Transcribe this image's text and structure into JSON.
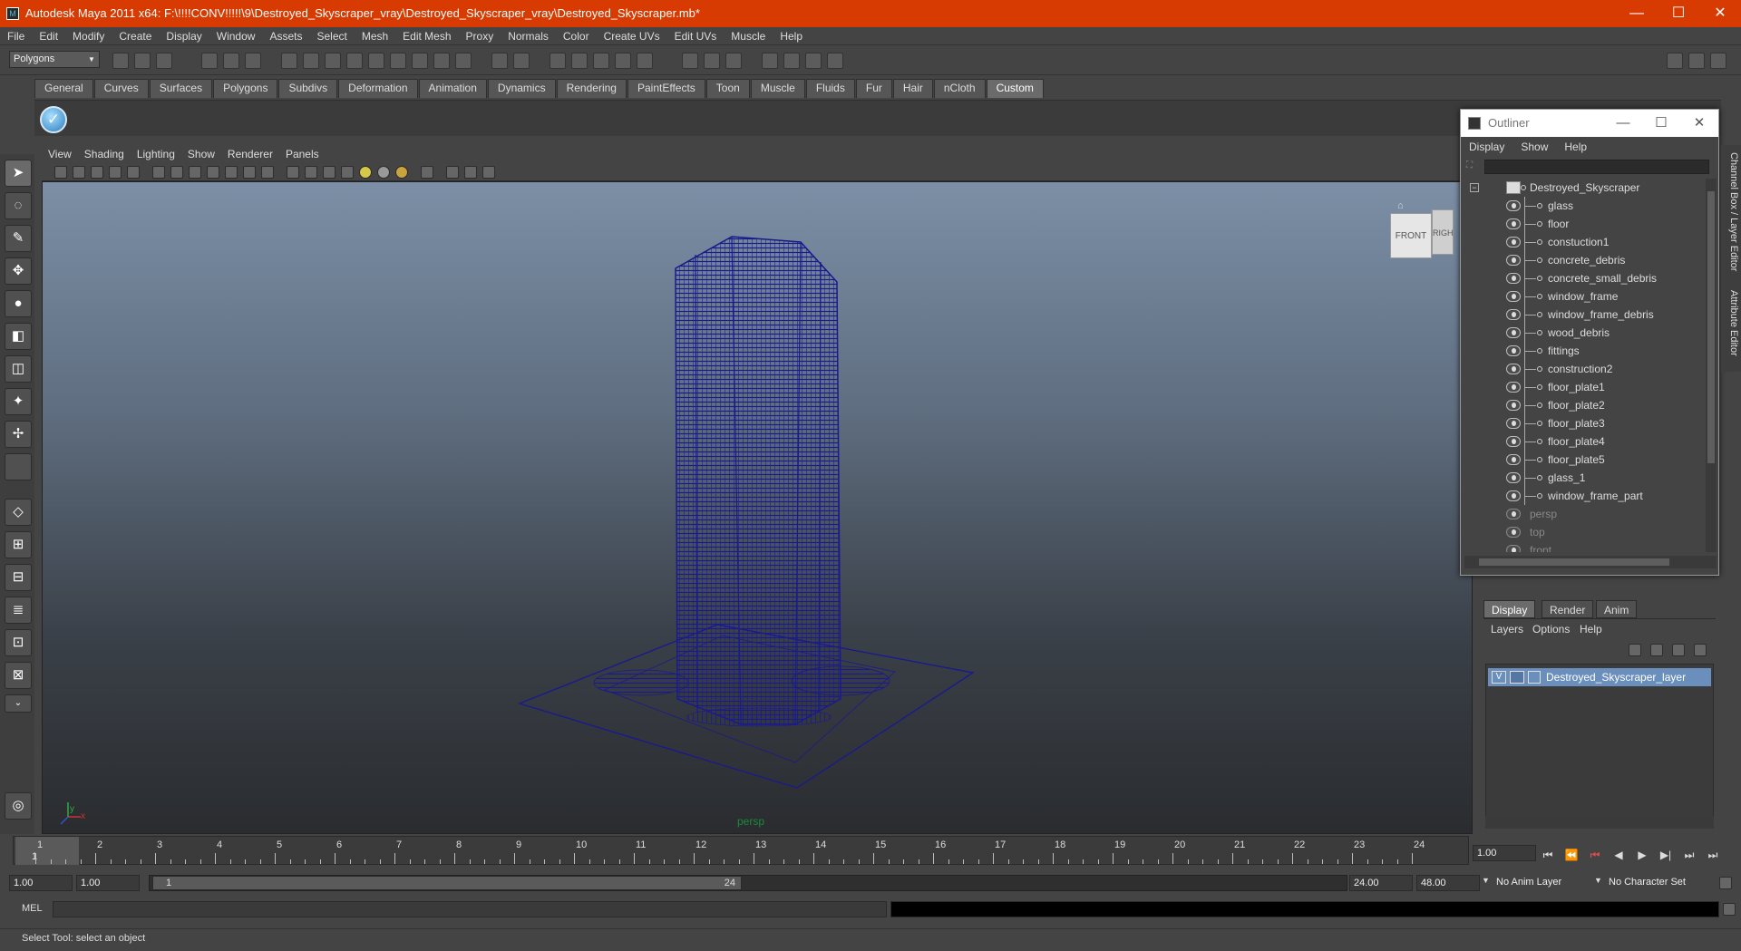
{
  "window": {
    "title": "Autodesk Maya 2011 x64: F:\\!!!!CONV!!!!!\\9\\Destroyed_Skyscraper_vray\\Destroyed_Skyscraper_vray\\Destroyed_Skyscraper.mb*",
    "minimize": "—",
    "maximize": "☐",
    "close": "✕",
    "accent": "#d83b01"
  },
  "menubar": [
    "File",
    "Edit",
    "Modify",
    "Create",
    "Display",
    "Window",
    "Assets",
    "Select",
    "Mesh",
    "Edit Mesh",
    "Proxy",
    "Normals",
    "Color",
    "Create UVs",
    "Edit UVs",
    "Muscle",
    "Help"
  ],
  "statusline": {
    "mode_select": "Polygons"
  },
  "shelf": {
    "tabs": [
      "General",
      "Curves",
      "Surfaces",
      "Polygons",
      "Subdivs",
      "Deformation",
      "Animation",
      "Dynamics",
      "Rendering",
      "PaintEffects",
      "Toon",
      "Muscle",
      "Fluids",
      "Fur",
      "Hair",
      "nCloth",
      "Custom"
    ],
    "active_tab": "Custom",
    "icon": "✓"
  },
  "viewport": {
    "menu": [
      "View",
      "Shading",
      "Lighting",
      "Show",
      "Renderer",
      "Panels"
    ],
    "camera_label": "persp",
    "viewcube_front": "FRONT",
    "viewcube_right": "RIGHT",
    "axis_x": "x",
    "axis_y": "y",
    "wire_color": "#1a1a8c"
  },
  "outliner": {
    "title": "Outliner",
    "menu": [
      "Display",
      "Show",
      "Help"
    ],
    "collapse_glyph": "−",
    "root": "Destroyed_Skyscraper",
    "children": [
      "glass",
      "floor",
      "constuction1",
      "concrete_debris",
      "concrete_small_debris",
      "window_frame",
      "window_frame_debris",
      "wood_debris",
      "fittings",
      "construction2",
      "floor_plate1",
      "floor_plate2",
      "floor_plate3",
      "floor_plate4",
      "floor_plate5",
      "glass_1",
      "window_frame_part"
    ],
    "cameras": [
      "persp",
      "top",
      "front"
    ]
  },
  "side_tabs": [
    "Channel Box / Layer Editor",
    "Attribute Editor"
  ],
  "layer_editor": {
    "tabs": [
      "Display",
      "Render",
      "Anim"
    ],
    "active_tab": "Display",
    "menu": [
      "Layers",
      "Options",
      "Help"
    ],
    "layer": {
      "visible": "V",
      "name": "Destroyed_Skyscraper_layer"
    }
  },
  "timeslider": {
    "ticks": [
      "1",
      "2",
      "3",
      "4",
      "5",
      "6",
      "7",
      "8",
      "9",
      "10",
      "11",
      "12",
      "13",
      "14",
      "15",
      "16",
      "17",
      "18",
      "19",
      "20",
      "21",
      "22",
      "23",
      "24"
    ],
    "current_frame": "1",
    "frame_field": "1.00",
    "playback": [
      "⏮",
      "⏪",
      "⏮",
      "◀",
      "▶",
      "▶|",
      "⏭",
      "⏭"
    ]
  },
  "range": {
    "start": "1.00",
    "playback_start": "1.00",
    "thumb_start": "1",
    "thumb_end": "24",
    "playback_end": "24.00",
    "end": "48.00",
    "anim_layer": "No Anim Layer",
    "character_set": "No Character Set"
  },
  "cmdline": {
    "label": "MEL"
  },
  "helpline": {
    "text": "Select Tool: select an object"
  }
}
